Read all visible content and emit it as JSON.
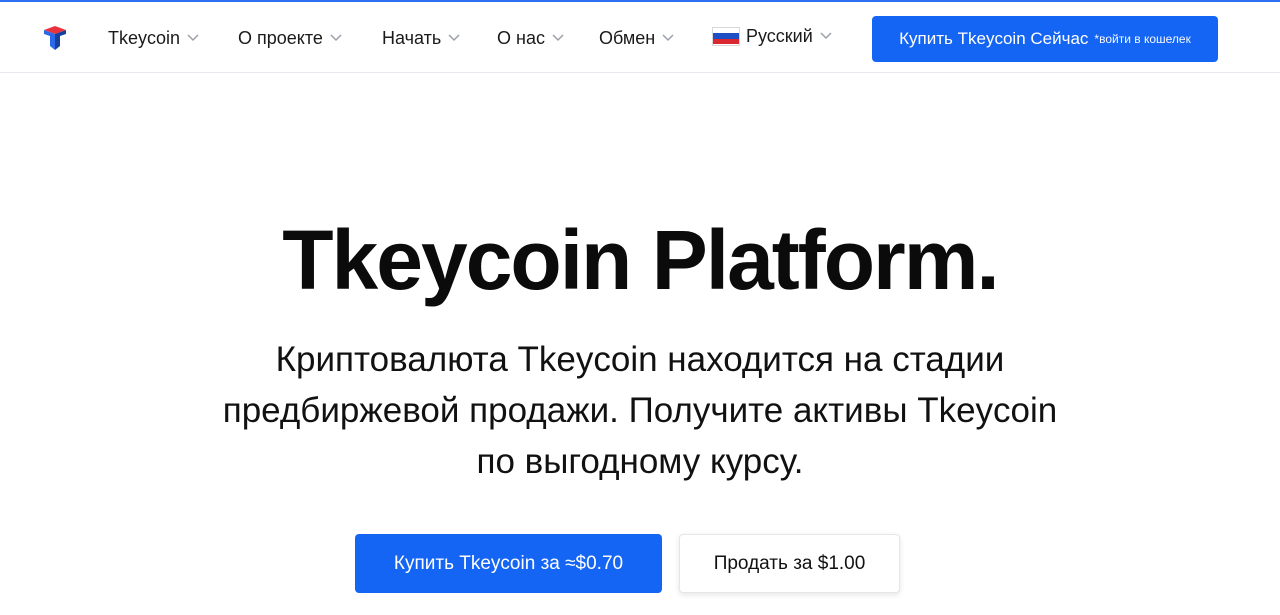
{
  "header": {
    "nav": [
      {
        "label": "Tkeycoin"
      },
      {
        "label": "О проекте"
      },
      {
        "label": "Начать"
      },
      {
        "label": "О нас"
      },
      {
        "label": "Обмен"
      }
    ],
    "language": {
      "label": "Русский",
      "flag_icon": "russia-flag-icon"
    },
    "cta": {
      "label": "Купить Tkeycoin Сейчас",
      "note": "*войти в кошелек"
    }
  },
  "hero": {
    "title": "Tkeycoin Platform.",
    "subtitle": "Криптовалюта Tkeycoin находится на стадии предбиржевой продажи. Получите активы Tkeycoin по выгодному курсу.",
    "buy_button": "Купить Tkeycoin за ≈$0.70",
    "sell_button": "Продать за $1.00"
  },
  "colors": {
    "accent": "#1465f4",
    "logo_red": "#e8333f",
    "logo_blue": "#1d5fe0"
  }
}
